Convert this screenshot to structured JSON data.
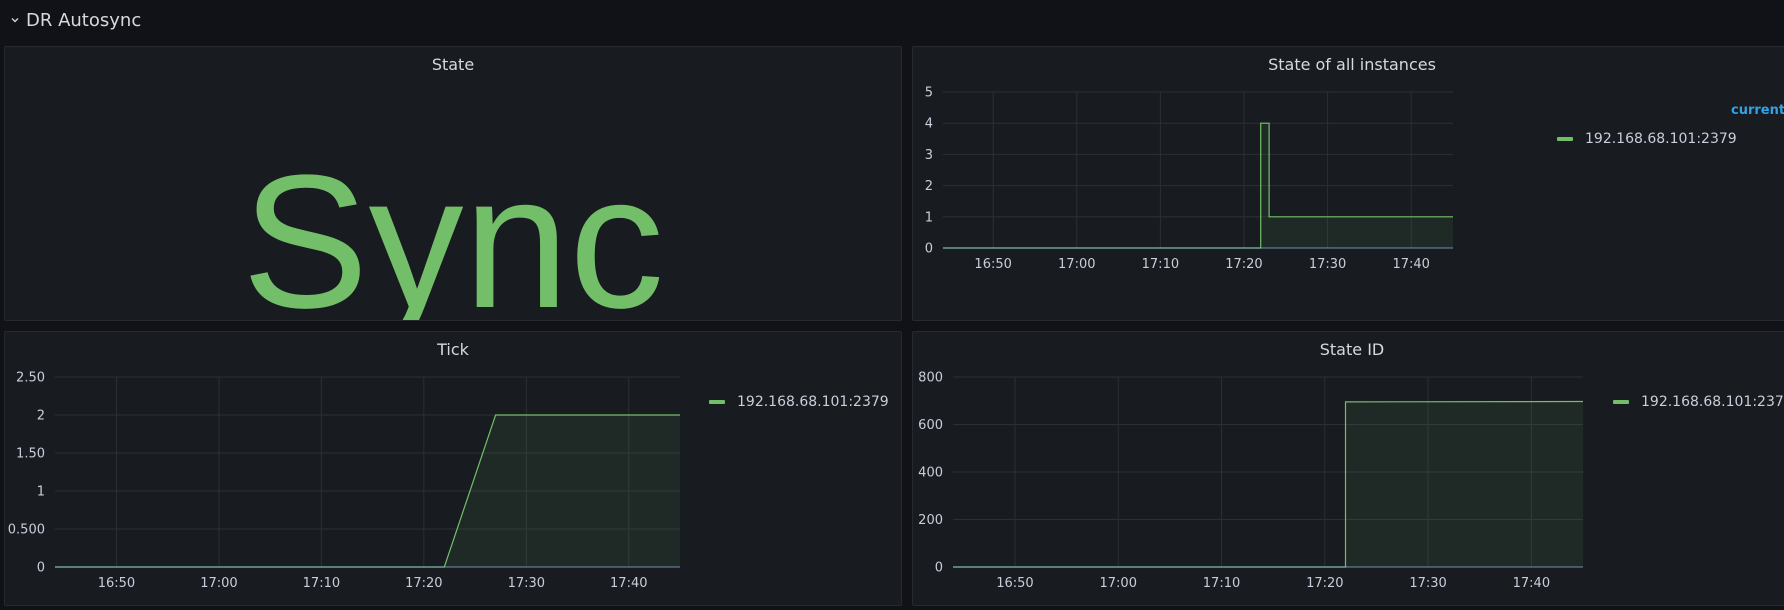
{
  "row": {
    "title": "DR Autosync"
  },
  "colors": {
    "background": "#111217",
    "panel": "#181b1f",
    "series": "#73bf69",
    "legend_header": "#33a2e5",
    "grid": "#2c2f35",
    "axis_text": "#ccccdc"
  },
  "icons": {
    "row_toggle": "chevron-down-icon",
    "legend_swatch": "series-line-swatch"
  },
  "panels": {
    "state": {
      "title": "State",
      "value": "Sync",
      "value_color": "#73bf69"
    },
    "state_all": {
      "title": "State of all instances",
      "legend_header": "current",
      "legend": [
        "192.168.68.101:2379"
      ]
    },
    "tick": {
      "title": "Tick",
      "legend": [
        "192.168.68.101:2379"
      ]
    },
    "state_id": {
      "title": "State ID",
      "legend": [
        "192.168.68.101:2379"
      ]
    }
  },
  "chart_data": [
    {
      "panel": "state_all",
      "type": "line",
      "title": "State of all instances",
      "x_ticks": [
        "16:50",
        "17:00",
        "17:10",
        "17:20",
        "17:30",
        "17:40"
      ],
      "y_ticks": [
        "0",
        "1",
        "2",
        "3",
        "4",
        "5"
      ],
      "xlim": [
        "16:44",
        "17:45"
      ],
      "ylim": [
        0,
        5
      ],
      "grid": true,
      "legend_position": "right",
      "series": [
        {
          "name": "192.168.68.101:2379",
          "fill": true,
          "points": [
            {
              "x": "16:44",
              "y": 0
            },
            {
              "x": "17:22",
              "y": 0
            },
            {
              "x": "17:22",
              "y": 4
            },
            {
              "x": "17:23",
              "y": 4
            },
            {
              "x": "17:23",
              "y": 1
            },
            {
              "x": "17:45",
              "y": 1
            }
          ]
        }
      ]
    },
    {
      "panel": "tick",
      "type": "line",
      "title": "Tick",
      "x_ticks": [
        "16:50",
        "17:00",
        "17:10",
        "17:20",
        "17:30",
        "17:40"
      ],
      "y_ticks": [
        "0",
        "0.500",
        "1",
        "1.50",
        "2",
        "2.50"
      ],
      "xlim": [
        "16:44",
        "17:45"
      ],
      "ylim": [
        0,
        2.5
      ],
      "grid": true,
      "legend_position": "right",
      "series": [
        {
          "name": "192.168.68.101:2379",
          "fill": true,
          "points": [
            {
              "x": "16:44",
              "y": 0
            },
            {
              "x": "17:22",
              "y": 0
            },
            {
              "x": "17:27",
              "y": 2
            },
            {
              "x": "17:45",
              "y": 2
            }
          ]
        }
      ]
    },
    {
      "panel": "state_id",
      "type": "line",
      "title": "State ID",
      "x_ticks": [
        "16:50",
        "17:00",
        "17:10",
        "17:20",
        "17:30",
        "17:40"
      ],
      "y_ticks": [
        "0",
        "200",
        "400",
        "600",
        "800"
      ],
      "xlim": [
        "16:44",
        "17:45"
      ],
      "ylim": [
        0,
        800
      ],
      "grid": true,
      "legend_position": "right",
      "series": [
        {
          "name": "192.168.68.101:2379",
          "fill": true,
          "points": [
            {
              "x": "16:44",
              "y": 0
            },
            {
              "x": "17:22",
              "y": 0
            },
            {
              "x": "17:22",
              "y": 695
            },
            {
              "x": "17:45",
              "y": 697
            }
          ]
        }
      ]
    }
  ]
}
